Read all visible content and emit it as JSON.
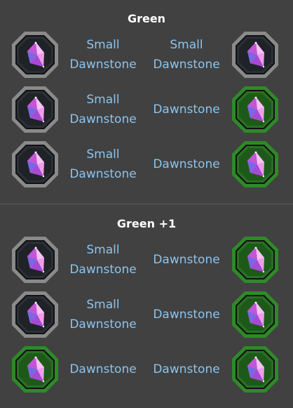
{
  "sections": [
    {
      "title": "Green",
      "rows": [
        {
          "left_icon": "gray-frame-gem-icon",
          "left_label": "Small\nDawnstone",
          "right_label": "Small\nDawnstone",
          "right_icon": "gray-frame-gem-icon"
        },
        {
          "left_icon": "gray-frame-gem-icon",
          "left_label": "Small\nDawnstone",
          "right_label": "Dawnstone",
          "right_icon": "green-frame-gem-icon"
        },
        {
          "left_icon": "gray-frame-gem-icon",
          "left_label": "Small\nDawnstone",
          "right_label": "Dawnstone",
          "right_icon": "green-frame-gem-icon"
        }
      ]
    },
    {
      "title": "Green +1",
      "rows": [
        {
          "left_icon": "gray-frame-gem-icon",
          "left_label": "Small\nDawnstone",
          "right_label": "Dawnstone",
          "right_icon": "green-frame-gem-icon"
        },
        {
          "left_icon": "gray-frame-gem-icon",
          "left_label": "Small\nDawnstone",
          "right_label": "Dawnstone",
          "right_icon": "green-frame-gem-icon"
        },
        {
          "left_icon": "green-frame-gem-icon",
          "left_label": "Dawnstone",
          "right_label": "Dawnstone",
          "right_icon": "green-frame-gem-icon"
        }
      ]
    }
  ],
  "colors": {
    "background": "#414141",
    "label": "#8cc4ef",
    "title": "#ffffff",
    "gray_frame": "#8a8a8a",
    "green_frame": "#2e8a28",
    "gem_pink": "#e07be0",
    "gem_blue": "#6f86e8"
  }
}
